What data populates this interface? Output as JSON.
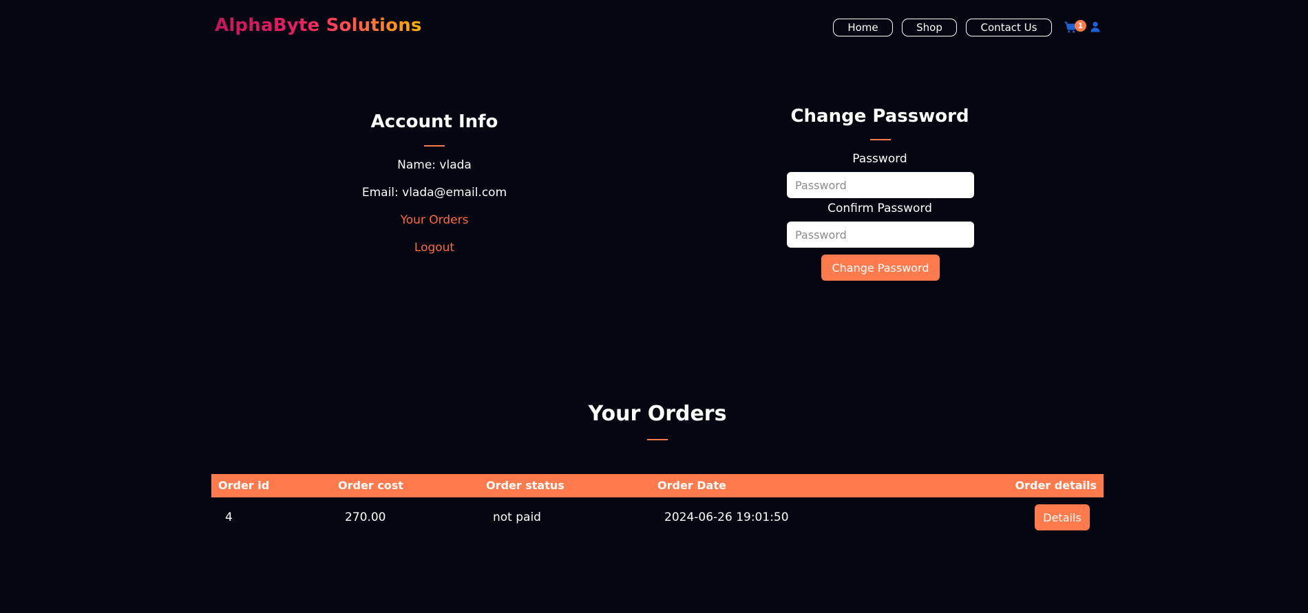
{
  "header": {
    "brand": "AlphaByte Solutions",
    "nav": [
      "Home",
      "Shop",
      "Contact Us"
    ],
    "cart_count": "1",
    "cart_icon": "cart-icon",
    "user_icon": "user-icon"
  },
  "account": {
    "title": "Account Info",
    "name_line": "Name: vlada",
    "email_line": "Email: vlada@email.com",
    "orders_link": "Your Orders",
    "logout_link": "Logout"
  },
  "password": {
    "title": "Change Password",
    "password_label": "Password",
    "password_placeholder": "Password",
    "confirm_label": "Confirm Password",
    "confirm_placeholder": "Password",
    "submit_label": "Change Password"
  },
  "orders": {
    "title": "Your Orders",
    "columns": [
      "Order id",
      "Order cost",
      "Order status",
      "Order Date",
      "Order details"
    ],
    "rows": [
      {
        "id": "4",
        "cost": "270.00",
        "status": "not paid",
        "date": "2024-06-26 19:01:50",
        "details_label": "Details"
      }
    ]
  },
  "colors": {
    "background": "#040612",
    "accent": "#ff7a4d",
    "link": "#ff6a3d",
    "icon_blue": "#1e63d6"
  }
}
